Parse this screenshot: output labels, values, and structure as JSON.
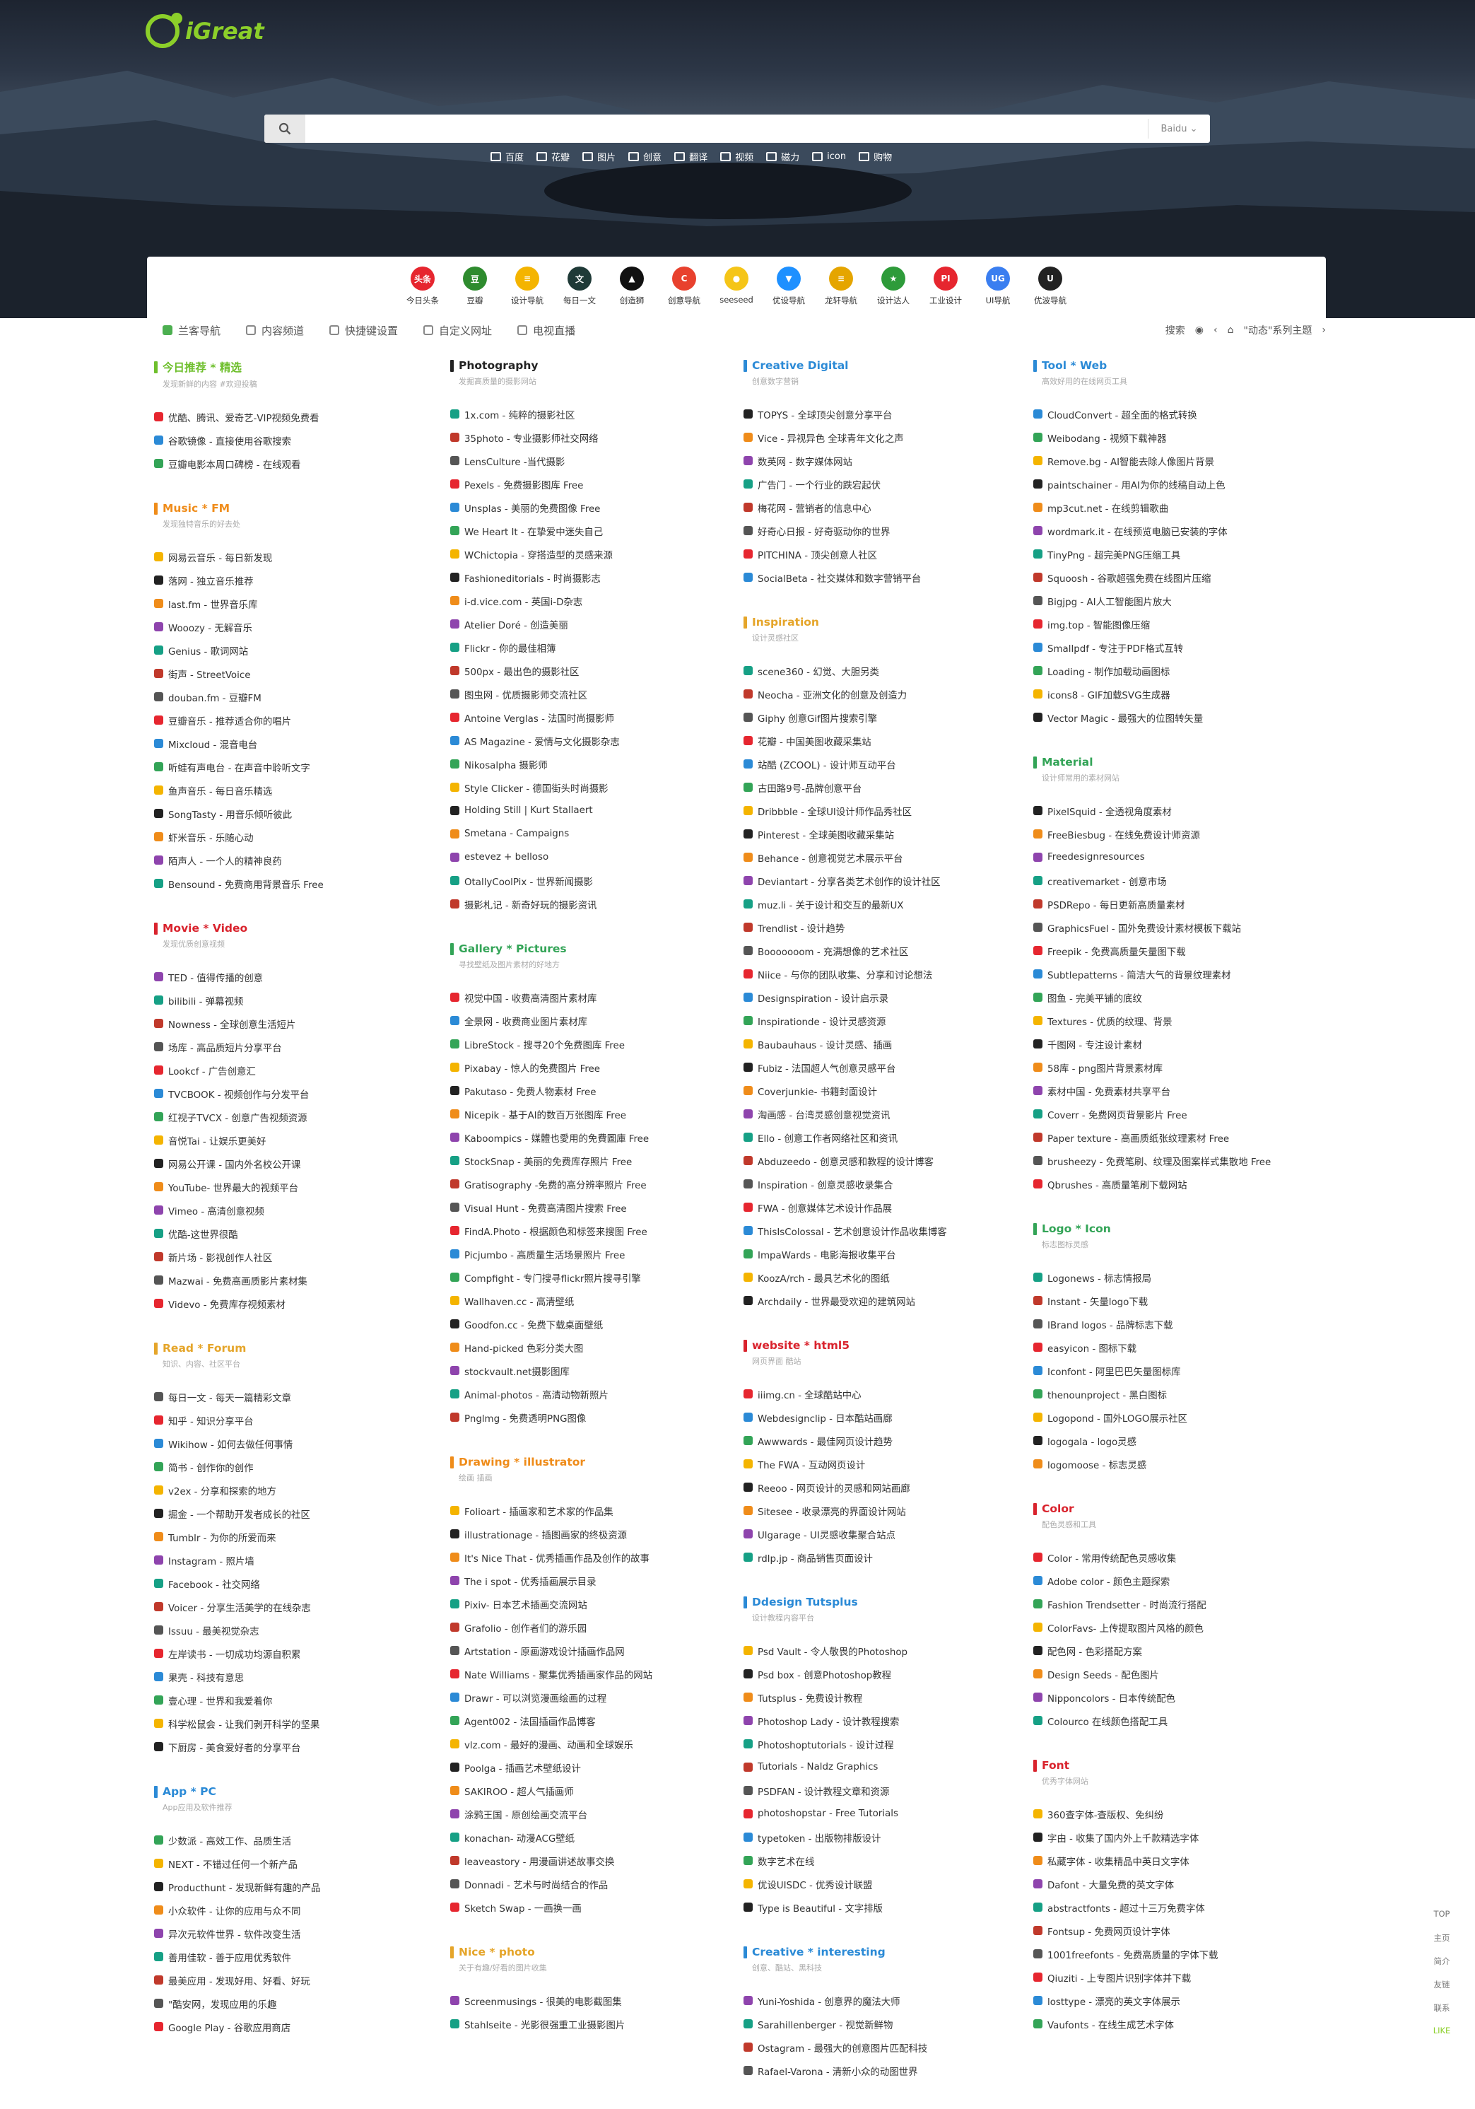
{
  "brand": {
    "name": "iGreat"
  },
  "search": {
    "placeholder": "",
    "engine": "Baidu"
  },
  "quick_links": [
    "百度",
    "花瓣",
    "图片",
    "创意",
    "翻译",
    "视频",
    "磁力",
    "icon",
    "购物"
  ],
  "top_nav": [
    {
      "label": "今日头条",
      "badge": "头条",
      "color": "#e6262f"
    },
    {
      "label": "豆瓣",
      "badge": "豆",
      "color": "#2e8b2e"
    },
    {
      "label": "设计导航",
      "badge": "≡",
      "color": "#f4b400"
    },
    {
      "label": "每日一文",
      "badge": "文",
      "color": "#1f3a37"
    },
    {
      "label": "创造狮",
      "badge": "▲",
      "color": "#111111"
    },
    {
      "label": "创意导航",
      "badge": "C",
      "color": "#e8412e"
    },
    {
      "label": "seeseed",
      "badge": "●",
      "color": "#f5c518"
    },
    {
      "label": "优设导航",
      "badge": "▼",
      "color": "#1e90ff"
    },
    {
      "label": "龙轩导航",
      "badge": "≡",
      "color": "#e5a500"
    },
    {
      "label": "设计达人",
      "badge": "★",
      "color": "#2e9b3a"
    },
    {
      "label": "工业设计",
      "badge": "PI",
      "color": "#e6262f"
    },
    {
      "label": "UI导航",
      "badge": "UG",
      "color": "#3a7ef0"
    },
    {
      "label": "优波导航",
      "badge": "U",
      "color": "#222222"
    }
  ],
  "tabs": [
    "兰客导航",
    "内容频道",
    "快捷键设置",
    "自定义网址",
    "电视直播"
  ],
  "right_bar": {
    "search_label": "搜索",
    "series_label": "\"动态\"系列主题"
  },
  "columns": [
    [
      {
        "title": "今日推荐 * 精选",
        "subtitle": "发现新鲜的内容 #欢迎投稿",
        "color": "#6ebf2c",
        "items": [
          "优酷、腾讯、爱奇艺-VIP视频免费看",
          "谷歌镜像 - 直接使用谷歌搜索",
          "豆瓣电影本周口碑榜 - 在线观看"
        ]
      },
      {
        "title": "Music * FM",
        "subtitle": "发现独特音乐的好去处",
        "color": "#ef8c1a",
        "items": [
          "网易云音乐 - 每日新发现",
          "落网 - 独立音乐推荐",
          "last.fm - 世界音乐库",
          "Wooozy - 无解音乐",
          "Genius - 歌词网站",
          "街声 - StreetVoice",
          "douban.fm - 豆瓣FM",
          "豆瓣音乐 - 推荐适合你的唱片",
          "Mixcloud - 混音电台",
          "听蛙有声电台 - 在声音中聆听文字",
          "鱼声音乐 - 每日音乐精选",
          "SongTasty - 用音乐倾听彼此",
          "虾米音乐 - 乐随心动",
          "陌声人 - 一个人的精神良药",
          "Bensound - 免费商用背景音乐 Free"
        ]
      },
      {
        "title": "Movie * Video",
        "subtitle": "发现优质创意视频",
        "color": "#d9232d",
        "items": [
          "TED - 值得传播的创意",
          "bilibili - 弹幕视频",
          "Nowness - 全球创意生活短片",
          "场库 - 高品质短片分享平台",
          "Lookcf - 广告创意汇",
          "TVCBOOK - 视频创作与分发平台",
          "红视子TVCX - 创意广告视频资源",
          "音悦Tai - 让娱乐更美好",
          "网易公开课 - 国内外名校公开课",
          "YouTube- 世界最大的视频平台",
          "Vimeo - 高清创意视频",
          "优酷-这世界很酷",
          "新片场 - 影视创作人社区",
          "Mazwai - 免费高画质影片素材集",
          "Videvo - 免费库存视频素材"
        ]
      },
      {
        "title": "Read * Forum",
        "subtitle": "知识、内容、社区平台",
        "color": "#e5a52a",
        "items": [
          "每日一文 - 每天一篇精彩文章",
          "知乎 - 知识分享平台",
          "Wikihow - 如何去做任何事情",
          "简书 - 创作你的创作",
          "v2ex - 分享和探索的地方",
          "掘金 - 一个帮助开发者成长的社区",
          "Tumblr - 为你的所爱而来",
          "Instagram - 照片墙",
          "Facebook - 社交网络",
          "Voicer - 分享生活美学的在线杂志",
          "Issuu - 最美视觉杂志",
          "左岸读书 - 一切成功均源自积累",
          "果壳 - 科技有意思",
          "壹心理 - 世界和我爱着你",
          "科学松鼠会 - 让我们剥开科学的坚果",
          "下厨房 - 美食爱好者的分享平台"
        ]
      },
      {
        "title": "App * PC",
        "subtitle": "App应用及软件推荐",
        "color": "#2b8ad6",
        "items": [
          "少数派 - 高效工作、品质生活",
          "NEXT - 不错过任何一个新产品",
          "Producthunt - 发现新鲜有趣的产品",
          "小众软件 - 让你的应用与众不同",
          "异次元软件世界 - 软件改变生活",
          "善用佳软 - 善于应用优秀软件",
          "最美应用 - 发现好用、好看、好玩",
          "\"酷安网，发现应用的乐趣",
          "Google Play - 谷歌应用商店"
        ]
      }
    ],
    [
      {
        "title": "Photography",
        "subtitle": "发掘高质量的摄影网站",
        "color": "#222222",
        "items": [
          "1x.com - 纯粹的摄影社区",
          "35photo - 专业摄影师社交网络",
          "LensCulture -当代摄影",
          "Pexels - 免费摄影图库 Free",
          "Unsplas - 美丽的免费图像 Free",
          "We Heart It - 在挚爱中迷失自己",
          "WChictopia - 穿搭造型的灵感来源",
          "Fashioneditorials - 时尚摄影志",
          "i-d.vice.com - 英国i-D杂志",
          "Atelier Doré - 创造美丽",
          "Flickr - 你的最佳相簿",
          "500px - 最出色的摄影社区",
          "图虫网 - 优质摄影师交流社区",
          "Antoine Verglas - 法国时尚摄影师",
          "AS Magazine - 爱情与文化摄影杂志",
          "Nikosalpha 摄影师",
          "Style Clicker - 德国街头时尚摄影",
          "Holding Still | Kurt Stallaert",
          "Smetana - Campaigns",
          "estevez + belloso",
          "OtallyCoolPix - 世界新闻摄影",
          "摄影札记 - 新奇好玩的摄影资讯"
        ]
      },
      {
        "title": "Gallery * Pictures",
        "subtitle": "寻找壁纸及图片素材的好地方",
        "color": "#33a457",
        "items": [
          "视觉中国 - 收费高清图片素材库",
          "全景网 - 收费商业图片素材库",
          "LibreStock - 搜寻20个免费图库 Free",
          "Pixabay - 惊人的免费图片 Free",
          "Pakutaso - 免费人物素材 Free",
          "Nicepik - 基于AI的数百万张图库 Free",
          "Kaboompics - 媒體也愛用的免費圖庫 Free",
          "StockSnap - 美丽的免费库存照片 Free",
          "Gratisography -免费的高分辨率照片 Free",
          "Visual Hunt - 免费高清图片搜索 Free",
          "FindA.Photo - 根据颜色和标签来搜图 Free",
          "Picjumbo - 高质量生活场景照片 Free",
          "Compfight - 专门搜寻flickr照片搜寻引擎",
          "Wallhaven.cc - 高清壁纸",
          "Goodfon.cc - 免费下载桌面壁纸",
          "Hand-picked 色彩分类大图",
          "stockvault.net摄影图库",
          "Animal-photos - 高清动物新照片",
          "Pnglmg - 免费透明PNG图像"
        ]
      },
      {
        "title": "Drawing * illustrator",
        "subtitle": "绘画 插画",
        "color": "#ef8c1a",
        "items": [
          "Folioart - 插画家和艺术家的作品集",
          "illustrationage - 插图画家的终极资源",
          "It's Nice That - 优秀插画作品及创作的故事",
          "The i spot - 优秀插画展示目录",
          "Pixiv- 日本艺术插画交流网站",
          "Grafolio - 创作者们的游乐园",
          "Artstation - 原画游戏设计插画作品网",
          "Nate Williams - 聚集优秀插画家作品的网站",
          "Drawr - 可以浏览漫画绘画的过程",
          "Agent002 - 法国插画作品博客",
          "vlz.com - 最好的漫画、动画和全球娱乐",
          "Poolga - 插画艺术壁纸设计",
          "SAKIROO - 超人气插画师",
          "涂鸦王国 - 原创绘画交流平台",
          "konachan- 动漫ACG壁纸",
          "leaveastory - 用漫画讲述故事交换",
          "Donnadi - 艺术与时尚结合的作品",
          "Sketch Swap - 一画换一画"
        ]
      },
      {
        "title": "Nice * photo",
        "subtitle": "关于有趣/好看的图片收集",
        "color": "#e5a52a",
        "items": [
          "Screenmusings - 很美的电影截图集",
          "Stahlseite - 光影很强重工业摄影图片"
        ]
      }
    ],
    [
      {
        "title": "Creative Digital",
        "subtitle": "创意数字营销",
        "color": "#2b8ad6",
        "items": [
          "TOPYS - 全球顶尖创意分享平台",
          "Vice - 异视异色 全球青年文化之声",
          "数英网 - 数字媒体网站",
          "广告门 - 一个行业的跌宕起伏",
          "梅花网 - 营销者的信息中心",
          "好奇心日报 - 好奇驱动你的世界",
          "PITCHINA - 顶尖创意人社区",
          "SocialBeta - 社交媒体和数字营销平台"
        ]
      },
      {
        "title": "Inspiration",
        "subtitle": "设计灵感社区",
        "color": "#e5a52a",
        "items": [
          "scene360 - 幻觉、大胆另类",
          "Neocha - 亚洲文化的创意及创造力",
          "Giphy 创意Gif图片搜索引擎",
          "花瓣 - 中国美图收藏采集站",
          "站酷 (ZCOOL) - 设计师互动平台",
          "古田路9号-品牌创意平台",
          "Dribbble - 全球UI设计师作品秀社区",
          "Pinterest - 全球美图收藏采集站",
          "Behance - 创意视觉艺术展示平台",
          "Deviantart - 分享各类艺术创作的设计社区",
          "muz.li - 关于设计和交互的最新UX",
          "Trendlist - 设计趋势",
          "Booooooom - 充满想像的艺术社区",
          "Niice - 与你的团队收集、分享和讨论想法",
          "Designspiration - 设计启示录",
          "Inspirationde - 设计灵感资源",
          "Baubauhaus - 设计灵感、插画",
          "Fubiz - 法国超人气创意灵感平台",
          "Coverjunkie- 书籍封面设计",
          "淘画感 - 台湾灵感创意视觉资讯",
          "Ello - 创意工作者网络社区和资讯",
          "Abduzeedo - 创意灵感和教程的设计博客",
          "Inspiration - 创意灵感收录集合",
          "FWA - 创意媒体艺术设计作品展",
          "ThisIsColossal - 艺术创意设计作品收集博客",
          "ImpaWards - 电影海报收集平台",
          "KoozA/rch - 最具艺术化的图纸",
          "Archdaily - 世界最受欢迎的建筑网站"
        ]
      },
      {
        "title": "website * html5",
        "subtitle": "网页界面 酷站",
        "color": "#d9232d",
        "items": [
          "iiimg.cn - 全球酷站中心",
          "Webdesignclip - 日本酷站画廊",
          "Awwwards - 最佳网页设计趋势",
          "The FWA - 互动网页设计",
          "Reeoo - 网页设计的灵感和网站画廊",
          "Sitesee - 收录漂亮的界面设计网站",
          "Ulgarage - UI灵感收集聚合站点",
          "rdlp.jp - 商品销售页面设计"
        ]
      },
      {
        "title": "Ddesign Tutsplus",
        "subtitle": "设计教程内容平台",
        "color": "#2b8ad6",
        "items": [
          "Psd Vault - 令人敬畏的Photoshop",
          "Psd box - 创意Photoshop教程",
          "Tutsplus - 免费设计教程",
          "Photoshop Lady - 设计教程搜索",
          "Photoshoptutorials - 设计过程",
          "Tutorials - Naldz Graphics",
          "PSDFAN - 设计教程文章和资源",
          "photoshopstar - Free Tutorials",
          "typetoken - 出版物排版设计",
          "数字艺术在线",
          "优设UISDC - 优秀设计联盟",
          "Type is Beautiful - 文字排版"
        ]
      },
      {
        "title": "Creative * interesting",
        "subtitle": "创意、酷站、黑科技",
        "color": "#2b8ad6",
        "items": [
          "Yuni-Yoshida - 创意界的魔法大师",
          "Sarahillenberger - 视觉新鲜物",
          "Ostagram - 最强大的创意图片匹配科技",
          "Rafael-Varona - 清新小众的动图世界"
        ]
      }
    ],
    [
      {
        "title": "Tool * Web",
        "subtitle": "高效好用的在线网页工具",
        "color": "#2b8ad6",
        "items": [
          "CloudConvert - 超全面的格式转换",
          "Weibodang - 视频下载神器",
          "Remove.bg - AI智能去除人像图片背景",
          "paintschainer - 用AI为你的线稿自动上色",
          "mp3cut.net - 在线剪辑歌曲",
          "wordmark.it - 在线预览电脑已安装的字体",
          "TinyPng - 超完美PNG压缩工具",
          "Squoosh - 谷歌超强免费在线图片压缩",
          "Bigjpg - AI人工智能图片放大",
          "img.top - 智能图像压缩",
          "Smallpdf - 专注于PDF格式互转",
          "Loading - 制作加载动画图标",
          "icons8 - GIF加载SVG生成器",
          "Vector Magic - 最强大的位图转矢量"
        ]
      },
      {
        "title": "Material",
        "subtitle": "设计师常用的素材网站",
        "color": "#33a457",
        "items": [
          "PixelSquid - 全透视角度素材",
          "FreeBiesbug - 在线免费设计师资源",
          "Freedesignresources",
          "creativemarket - 创意市场",
          "PSDRepo - 每日更新高质量素材",
          "GraphicsFuel - 国外免费设计素材模板下载站",
          "Freepik - 免费高质量矢量图下载",
          "Subtlepatterns - 简洁大气的背景纹理素材",
          "图鱼 - 完美平铺的底纹",
          "Textures - 优质的纹理、背景",
          "千图网 - 专注设计素材",
          "58库 - png图片背景素材库",
          "素材中国 - 免费素材共享平台",
          "Coverr - 免费网页背景影片 Free",
          "Paper texture - 高画质纸张纹理素材 Free",
          "brusheezy - 免费笔刷、纹理及图案样式集散地 Free",
          "Qbrushes - 高质量笔刷下载网站"
        ]
      },
      {
        "title": "Logo * Icon",
        "subtitle": "标志图标灵感",
        "color": "#33a457",
        "items": [
          "Logonews - 标志情报局",
          "Instant - 矢量logo下载",
          "IBrand logos - 品牌标志下载",
          "easyicon - 图标下载",
          "Iconfont - 阿里巴巴矢量图标库",
          "thenounproject - 黑白图标",
          "Logopond - 国外LOGO展示社区",
          "logogala - logo灵感",
          "logomoose - 标志灵感"
        ]
      },
      {
        "title": "Color",
        "subtitle": "配色灵感和工具",
        "color": "#d9232d",
        "items": [
          "Color - 常用传统配色灵感收集",
          "Adobe color - 颜色主题探索",
          "Fashion Trendsetter - 时尚流行搭配",
          "ColorFavs- 上传提取图片风格的颜色",
          "配色网 - 色彩搭配方案",
          "Design Seeds - 配色图片",
          "Nipponcolors - 日本传统配色",
          "Colourco 在线颜色搭配工具"
        ]
      },
      {
        "title": "Font",
        "subtitle": "优秀字体网站",
        "color": "#d9232d",
        "items": [
          "360查字体-查版权、免纠纷",
          "字由 - 收集了国内外上千款精选字体",
          "私藏字体 - 收集精品中英日文字体",
          "Dafont - 大量免费的英文字体",
          "abstractfonts - 超过十三万免费字体",
          "Fontsup - 免费网页设计字体",
          "1001freefonts - 免费高质量的字体下载",
          "Qiuziti - 上专图片识别字体并下载",
          "losttype - 漂亮的英文字体展示",
          "Vaufonts - 在线生成艺术字体"
        ]
      }
    ]
  ],
  "side_links": [
    "TOP",
    "主页",
    "简介",
    "友链",
    "联系",
    "LIKE"
  ]
}
